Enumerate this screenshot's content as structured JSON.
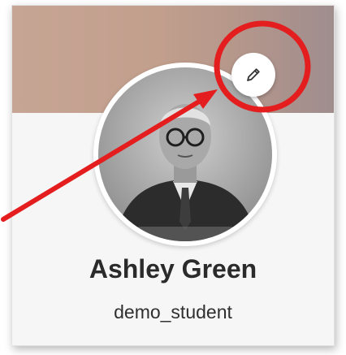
{
  "profile": {
    "display_name": "Ashley Green",
    "username": "demo_student"
  },
  "icons": {
    "edit": "pencil-icon"
  },
  "colors": {
    "annotation": "#e41e1e",
    "text": "#2b2b2b"
  }
}
